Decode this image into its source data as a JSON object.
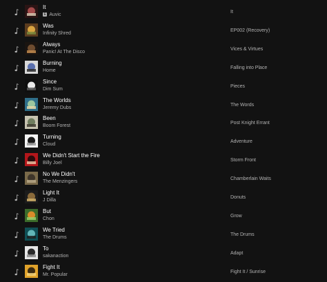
{
  "colors": {
    "background": "#121212",
    "title_text": "#ffffff",
    "secondary_text": "#b3b3b3"
  },
  "icons": {
    "track_icon": "music-note-icon"
  },
  "tracks": [
    {
      "title": "It",
      "artist": "Auvic",
      "album": "It",
      "explicit": true,
      "explicit_label": "E",
      "art_colors": [
        "#2a1414",
        "#a34a4a",
        "#d7c7b0"
      ]
    },
    {
      "title": "Was",
      "artist": "Infinity Shred",
      "album": "EP002 (Recovery)",
      "explicit": false,
      "art_colors": [
        "#5b3c1e",
        "#d9a441",
        "#7c8a3d"
      ]
    },
    {
      "title": "Always",
      "artist": "Panic! At The Disco",
      "album": "Vices & Virtues",
      "explicit": false,
      "art_colors": [
        "#1a1410",
        "#6e4c2f",
        "#c28a4e"
      ]
    },
    {
      "title": "Burning",
      "artist": "Home",
      "album": "Falling into Place",
      "explicit": false,
      "art_colors": [
        "#d8d8d8",
        "#5a6fae",
        "#2b2b2b"
      ]
    },
    {
      "title": "Since",
      "artist": "Dim Sum",
      "album": "Pieces",
      "explicit": false,
      "art_colors": [
        "#0f0f0f",
        "#e8e8e8",
        "#5a5a5a"
      ]
    },
    {
      "title": "The Worlds",
      "artist": "Jeremy Dubs",
      "album": "The Words",
      "explicit": false,
      "art_colors": [
        "#2f6f8a",
        "#9bc7a0",
        "#e7d9a8"
      ]
    },
    {
      "title": "Been",
      "artist": "Boom Forest",
      "album": "Post Knight Errant",
      "explicit": false,
      "art_colors": [
        "#c7c3b0",
        "#6f7d5e",
        "#3d3a2e"
      ]
    },
    {
      "title": "Turning",
      "artist": "Cloud",
      "album": "Adventure",
      "explicit": false,
      "art_colors": [
        "#f4f4f4",
        "#1a1a1a",
        "#9a9a9a"
      ]
    },
    {
      "title": "We Didn't Start the Fire",
      "artist": "Billy Joel",
      "album": "Storm Front",
      "explicit": false,
      "art_colors": [
        "#b3161b",
        "#2a0b0c",
        "#e8c0a0"
      ]
    },
    {
      "title": "No We Didn't",
      "artist": "The Menzingers",
      "album": "Chamberlain Waits",
      "explicit": false,
      "art_colors": [
        "#7a6a4a",
        "#3e352a",
        "#b9a887"
      ]
    },
    {
      "title": "Light It",
      "artist": "J Dilla",
      "album": "Donuts",
      "explicit": false,
      "art_colors": [
        "#1c1c1c",
        "#8a6a3a",
        "#d2b26a"
      ]
    },
    {
      "title": "But",
      "artist": "Chon",
      "album": "Grow",
      "explicit": false,
      "art_colors": [
        "#3b6b2a",
        "#d98b2a",
        "#9bd06a"
      ]
    },
    {
      "title": "We Tried",
      "artist": "The Drums",
      "album": "The Drums",
      "explicit": false,
      "art_colors": [
        "#0f4f55",
        "#62b6b8",
        "#1f1f1f"
      ]
    },
    {
      "title": "To",
      "artist": "sakanaction",
      "album": "Adapt",
      "explicit": false,
      "art_colors": [
        "#e6e6e6",
        "#2a2a2a",
        "#8c8c8c"
      ]
    },
    {
      "title": "Fight It",
      "artist": "Mr. Popular",
      "album": "Fight It / Sunrise",
      "explicit": false,
      "art_colors": [
        "#e0a22a",
        "#3a2a10",
        "#f3d27a"
      ]
    }
  ]
}
